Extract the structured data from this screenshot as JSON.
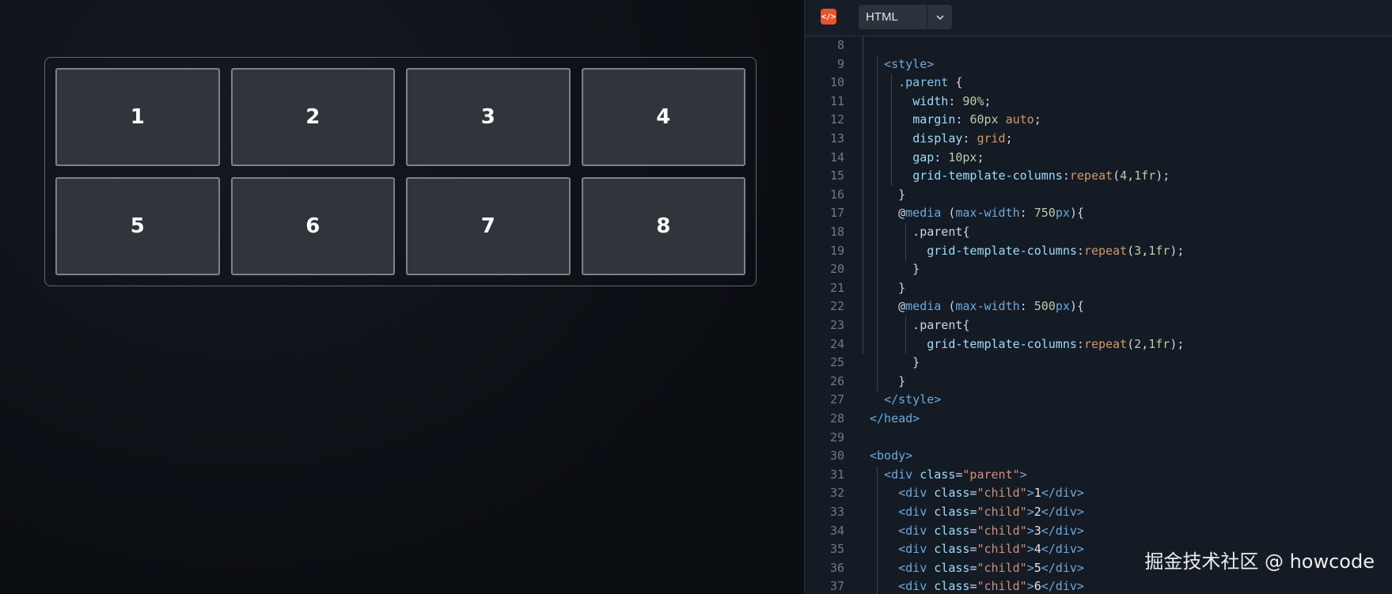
{
  "preview": {
    "cells": [
      "1",
      "2",
      "3",
      "4",
      "5",
      "6",
      "7",
      "8"
    ]
  },
  "editor": {
    "language": "HTML",
    "badge_icon": "html-code-icon",
    "lines": [
      {
        "n": "8",
        "tokens": []
      },
      {
        "n": "9",
        "tokens": [
          {
            "t": "  "
          },
          {
            "c": "tag",
            "t": "<style>"
          }
        ]
      },
      {
        "n": "10",
        "tokens": [
          {
            "t": "    "
          },
          {
            "c": "sel",
            "t": ".parent"
          },
          {
            "t": " {"
          }
        ]
      },
      {
        "n": "11",
        "tokens": [
          {
            "t": "      "
          },
          {
            "c": "prop",
            "t": "width"
          },
          {
            "t": ": "
          },
          {
            "c": "num",
            "t": "90%"
          },
          {
            "t": ";"
          }
        ]
      },
      {
        "n": "12",
        "tokens": [
          {
            "t": "      "
          },
          {
            "c": "prop",
            "t": "margin"
          },
          {
            "t": ": "
          },
          {
            "c": "num",
            "t": "60px"
          },
          {
            "t": " "
          },
          {
            "c": "val",
            "t": "auto"
          },
          {
            "t": ";"
          }
        ]
      },
      {
        "n": "13",
        "tokens": [
          {
            "t": "      "
          },
          {
            "c": "prop",
            "t": "display"
          },
          {
            "t": ": "
          },
          {
            "c": "val",
            "t": "grid"
          },
          {
            "t": ";"
          }
        ]
      },
      {
        "n": "14",
        "tokens": [
          {
            "t": "      "
          },
          {
            "c": "prop",
            "t": "gap"
          },
          {
            "t": ": "
          },
          {
            "c": "num",
            "t": "10px"
          },
          {
            "t": ";"
          }
        ]
      },
      {
        "n": "15",
        "tokens": [
          {
            "t": "      "
          },
          {
            "c": "prop",
            "t": "grid-template-columns"
          },
          {
            "t": ":"
          },
          {
            "c": "val",
            "t": "repeat"
          },
          {
            "t": "("
          },
          {
            "c": "num",
            "t": "4"
          },
          {
            "t": ","
          },
          {
            "c": "num",
            "t": "1fr"
          },
          {
            "t": ");"
          }
        ]
      },
      {
        "n": "16",
        "tokens": [
          {
            "t": "    }"
          }
        ]
      },
      {
        "n": "17",
        "tokens": [
          {
            "t": "    "
          },
          {
            "c": "at",
            "t": "@"
          },
          {
            "c": "tag",
            "t": "media"
          },
          {
            "t": " ("
          },
          {
            "c": "tag",
            "t": "max-width"
          },
          {
            "t": ": "
          },
          {
            "c": "num",
            "t": "750"
          },
          {
            "c": "tag",
            "t": "px"
          },
          {
            "t": "){"
          }
        ]
      },
      {
        "n": "18",
        "tokens": [
          {
            "t": "      .parent{"
          }
        ]
      },
      {
        "n": "19",
        "tokens": [
          {
            "t": "        "
          },
          {
            "c": "prop",
            "t": "grid-template-columns"
          },
          {
            "t": ":"
          },
          {
            "c": "val",
            "t": "repeat"
          },
          {
            "t": "("
          },
          {
            "c": "num",
            "t": "3"
          },
          {
            "t": ","
          },
          {
            "c": "num",
            "t": "1fr"
          },
          {
            "t": ");"
          }
        ]
      },
      {
        "n": "20",
        "tokens": [
          {
            "t": "      }"
          }
        ]
      },
      {
        "n": "21",
        "tokens": [
          {
            "t": "    }"
          }
        ]
      },
      {
        "n": "22",
        "tokens": [
          {
            "t": "    "
          },
          {
            "c": "at",
            "t": "@"
          },
          {
            "c": "tag",
            "t": "media"
          },
          {
            "t": " ("
          },
          {
            "c": "tag",
            "t": "max-width"
          },
          {
            "t": ": "
          },
          {
            "c": "num",
            "t": "500"
          },
          {
            "c": "tag",
            "t": "px"
          },
          {
            "t": "){"
          }
        ]
      },
      {
        "n": "23",
        "tokens": [
          {
            "t": "      .parent{"
          }
        ]
      },
      {
        "n": "24",
        "tokens": [
          {
            "t": "        "
          },
          {
            "c": "prop",
            "t": "grid-template-columns"
          },
          {
            "t": ":"
          },
          {
            "c": "val",
            "t": "repeat"
          },
          {
            "t": "("
          },
          {
            "c": "num",
            "t": "2"
          },
          {
            "t": ","
          },
          {
            "c": "num",
            "t": "1fr"
          },
          {
            "t": ");"
          }
        ]
      },
      {
        "n": "25",
        "tokens": [
          {
            "t": "      }"
          }
        ]
      },
      {
        "n": "26",
        "tokens": [
          {
            "t": "    }"
          }
        ]
      },
      {
        "n": "27",
        "tokens": [
          {
            "t": "  "
          },
          {
            "c": "tag",
            "t": "</style>"
          }
        ]
      },
      {
        "n": "28",
        "tokens": [
          {
            "c": "tag",
            "t": "</head>"
          }
        ]
      },
      {
        "n": "29",
        "tokens": []
      },
      {
        "n": "30",
        "tokens": [
          {
            "c": "tag",
            "t": "<body>"
          }
        ]
      },
      {
        "n": "31",
        "tokens": [
          {
            "t": "  "
          },
          {
            "c": "tag",
            "t": "<div"
          },
          {
            "t": " "
          },
          {
            "c": "prop",
            "t": "class"
          },
          {
            "t": "="
          },
          {
            "c": "str",
            "t": "\"parent\""
          },
          {
            "c": "tag",
            "t": ">"
          }
        ]
      },
      {
        "n": "32",
        "tokens": [
          {
            "t": "    "
          },
          {
            "c": "tag",
            "t": "<div"
          },
          {
            "t": " "
          },
          {
            "c": "prop",
            "t": "class"
          },
          {
            "t": "="
          },
          {
            "c": "str",
            "t": "\"child\""
          },
          {
            "c": "tag",
            "t": ">"
          },
          {
            "c": "text",
            "t": "1"
          },
          {
            "c": "tag",
            "t": "</div>"
          }
        ]
      },
      {
        "n": "33",
        "tokens": [
          {
            "t": "    "
          },
          {
            "c": "tag",
            "t": "<div"
          },
          {
            "t": " "
          },
          {
            "c": "prop",
            "t": "class"
          },
          {
            "t": "="
          },
          {
            "c": "str",
            "t": "\"child\""
          },
          {
            "c": "tag",
            "t": ">"
          },
          {
            "c": "text",
            "t": "2"
          },
          {
            "c": "tag",
            "t": "</div>"
          }
        ]
      },
      {
        "n": "34",
        "tokens": [
          {
            "t": "    "
          },
          {
            "c": "tag",
            "t": "<div"
          },
          {
            "t": " "
          },
          {
            "c": "prop",
            "t": "class"
          },
          {
            "t": "="
          },
          {
            "c": "str",
            "t": "\"child\""
          },
          {
            "c": "tag",
            "t": ">"
          },
          {
            "c": "text",
            "t": "3"
          },
          {
            "c": "tag",
            "t": "</div>"
          }
        ]
      },
      {
        "n": "35",
        "tokens": [
          {
            "t": "    "
          },
          {
            "c": "tag",
            "t": "<div"
          },
          {
            "t": " "
          },
          {
            "c": "prop",
            "t": "class"
          },
          {
            "t": "="
          },
          {
            "c": "str",
            "t": "\"child\""
          },
          {
            "c": "tag",
            "t": ">"
          },
          {
            "c": "text",
            "t": "4"
          },
          {
            "c": "tag",
            "t": "</div>"
          }
        ]
      },
      {
        "n": "36",
        "tokens": [
          {
            "t": "    "
          },
          {
            "c": "tag",
            "t": "<div"
          },
          {
            "t": " "
          },
          {
            "c": "prop",
            "t": "class"
          },
          {
            "t": "="
          },
          {
            "c": "str",
            "t": "\"child\""
          },
          {
            "c": "tag",
            "t": ">"
          },
          {
            "c": "text",
            "t": "5"
          },
          {
            "c": "tag",
            "t": "</div>"
          }
        ]
      },
      {
        "n": "37",
        "tokens": [
          {
            "t": "    "
          },
          {
            "c": "tag",
            "t": "<div"
          },
          {
            "t": " "
          },
          {
            "c": "prop",
            "t": "class"
          },
          {
            "t": "="
          },
          {
            "c": "str",
            "t": "\"child\""
          },
          {
            "c": "tag",
            "t": ">"
          },
          {
            "c": "text",
            "t": "6"
          },
          {
            "c": "tag",
            "t": "</div>"
          }
        ]
      }
    ]
  },
  "watermark": "掘金技术社区 @ howcode"
}
